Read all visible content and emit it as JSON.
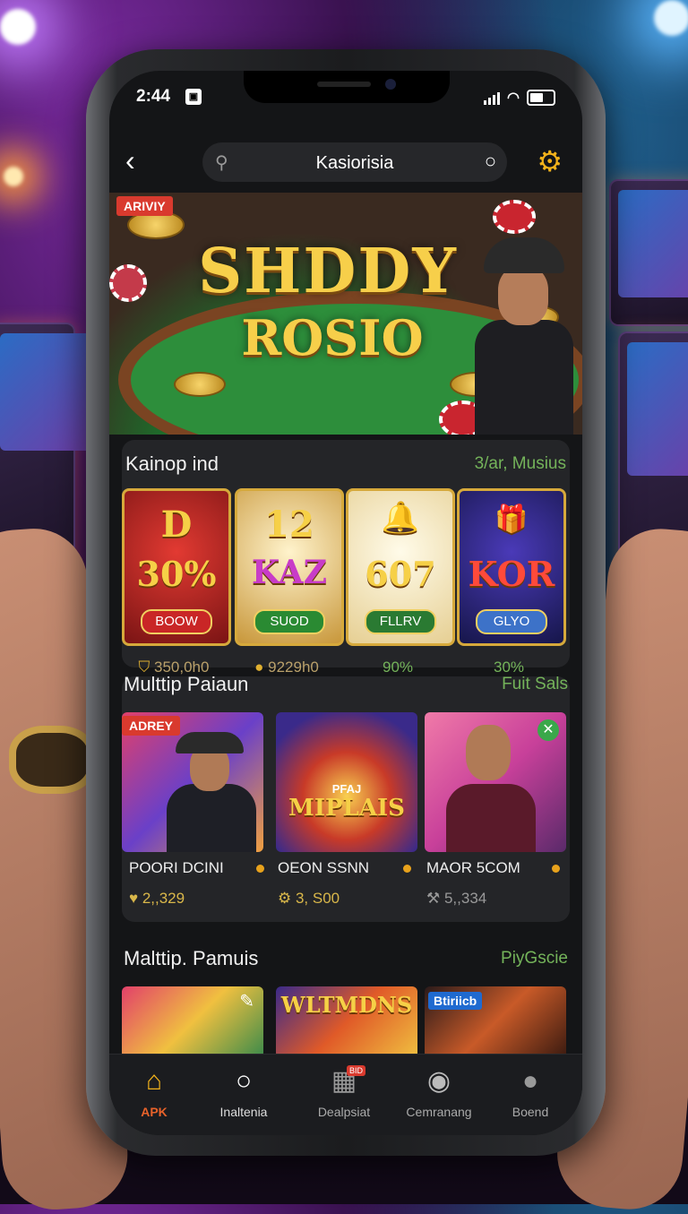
{
  "status": {
    "time": "2:44",
    "sim_icon": "sim-icon"
  },
  "header": {
    "search_title": "Kasiorisia"
  },
  "banner": {
    "tag": "ARIVIY",
    "title_line1": "SHDDY",
    "title_line2": "ROSIO"
  },
  "section1": {
    "title": "Kainop ind",
    "link": "3/ar, Musius",
    "cards": [
      {
        "top": "D",
        "middle": "30%",
        "button": "BOOW",
        "stat": "350,0h0",
        "colors": {
          "bg": "#b8272a",
          "pill": "#c92626"
        }
      },
      {
        "top": "12",
        "middle": "KAZ",
        "button": "SUOD",
        "stat": "9229h0",
        "colors": {
          "bg": "#e8c77c",
          "pill": "#2a8a32"
        }
      },
      {
        "top": "",
        "middle": "607",
        "button": "FLLRV",
        "stat": "90%",
        "colors": {
          "bg": "#f3e3b8",
          "pill": "#2a7a32"
        }
      },
      {
        "top": "",
        "middle": "KOR",
        "button": "GLYO",
        "stat": "30%",
        "colors": {
          "bg": "#2a2a7a",
          "pill": "#3d72c8"
        }
      }
    ]
  },
  "section2": {
    "title": "Multtip Paiaun",
    "link": "Fuit Sals",
    "tag": "ADREY",
    "games": [
      {
        "name": "POORI DCINI",
        "stat": "2,,329"
      },
      {
        "name": "OEON SSNN",
        "stat": "3, S00"
      },
      {
        "name": "MAOR 5COM",
        "stat": "5,,334"
      }
    ],
    "logo_small": "PFAJ",
    "logo_big": "MIPLAIS"
  },
  "section3": {
    "title": "Malttip. Pamuis",
    "link": "PiyGscie",
    "tile2_text": "WLTMDNS",
    "tile3_tag": "Btiriicb"
  },
  "nav": {
    "items": [
      {
        "label": "APK",
        "icon": "home-icon"
      },
      {
        "label": "Inaltenia",
        "icon": "search-icon"
      },
      {
        "label": "Dealpsiat",
        "icon": "grid-icon",
        "badge": "BID"
      },
      {
        "label": "Cemranang",
        "icon": "target-icon"
      },
      {
        "label": "Boend",
        "icon": "profile-icon"
      }
    ]
  },
  "colors": {
    "accent": "#f2b21b",
    "link": "#74b35a",
    "active_nav": "#f2b21b",
    "tag": "#d93a2e"
  }
}
